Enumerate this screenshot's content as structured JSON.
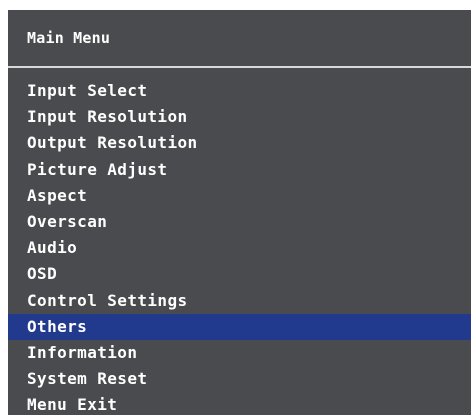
{
  "menu": {
    "title": "Main Menu",
    "selected_index": 9,
    "items": [
      {
        "label": "Input Select"
      },
      {
        "label": "Input Resolution"
      },
      {
        "label": "Output Resolution"
      },
      {
        "label": "Picture Adjust"
      },
      {
        "label": "Aspect"
      },
      {
        "label": "Overscan"
      },
      {
        "label": "Audio"
      },
      {
        "label": "OSD"
      },
      {
        "label": "Control Settings"
      },
      {
        "label": "Others"
      },
      {
        "label": "Information"
      },
      {
        "label": "System Reset"
      },
      {
        "label": "Menu Exit"
      }
    ]
  },
  "colors": {
    "background": "#4a4b4e",
    "selected": "#223a8e",
    "text": "#ffffff",
    "divider": "#d8d8d8"
  }
}
